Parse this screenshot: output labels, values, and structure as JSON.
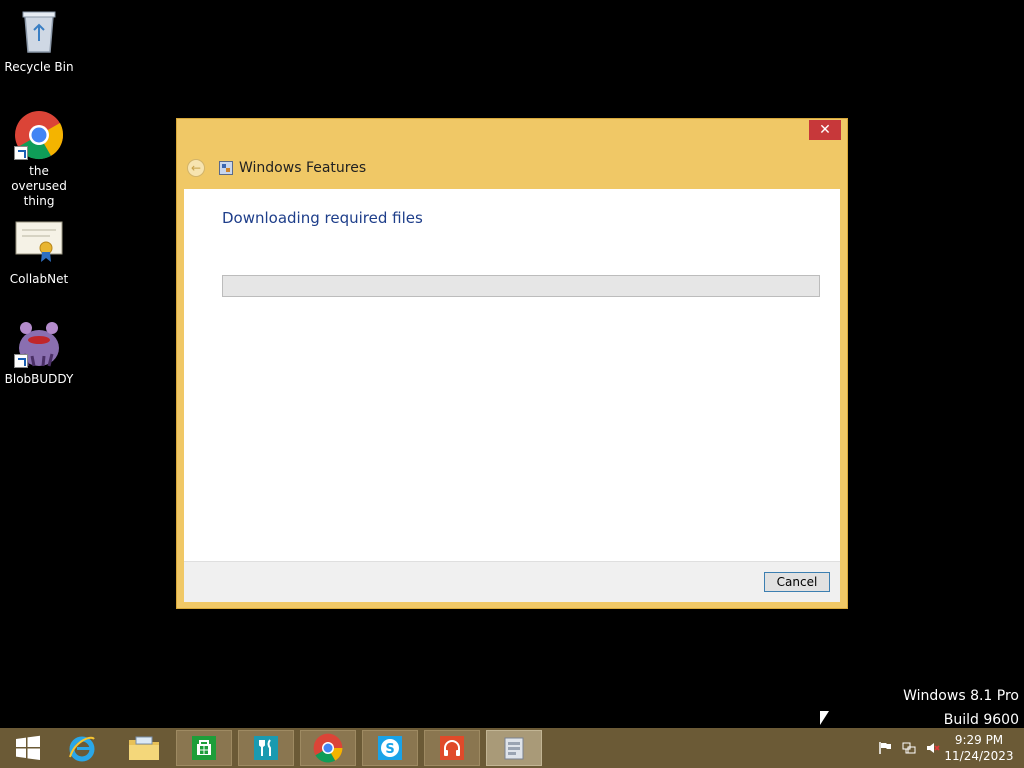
{
  "desktop": {
    "icons": [
      {
        "label": "Recycle Bin",
        "icon": "recycle-bin-icon"
      },
      {
        "label": "the overused thing",
        "icon": "chrome-icon"
      },
      {
        "label": "CollabNet",
        "icon": "certificate-icon"
      },
      {
        "label": "BlobBUDDY",
        "icon": "blob-icon"
      }
    ]
  },
  "dialog": {
    "title": "Windows Features",
    "close_glyph": "✕",
    "back_glyph": "←",
    "heading": "Downloading required files",
    "progress_fraction": 0,
    "cancel_label": "Cancel"
  },
  "watermark": {
    "line1": "Windows 8.1 Pro",
    "line2": "Build 9600"
  },
  "taskbar": {
    "items": [
      "start-icon",
      "internet-explorer-icon",
      "file-explorer-icon",
      "store-icon",
      "food-app-icon",
      "chrome-icon",
      "skype-icon",
      "music-icon",
      "windows-features-icon"
    ],
    "time": "9:29 PM",
    "date": "11/24/2023"
  },
  "colors": {
    "dialog_frame": "#f0c866",
    "heading_text": "#1e3e8a",
    "close_button": "#c7383a",
    "taskbar": "#6b5a36"
  }
}
